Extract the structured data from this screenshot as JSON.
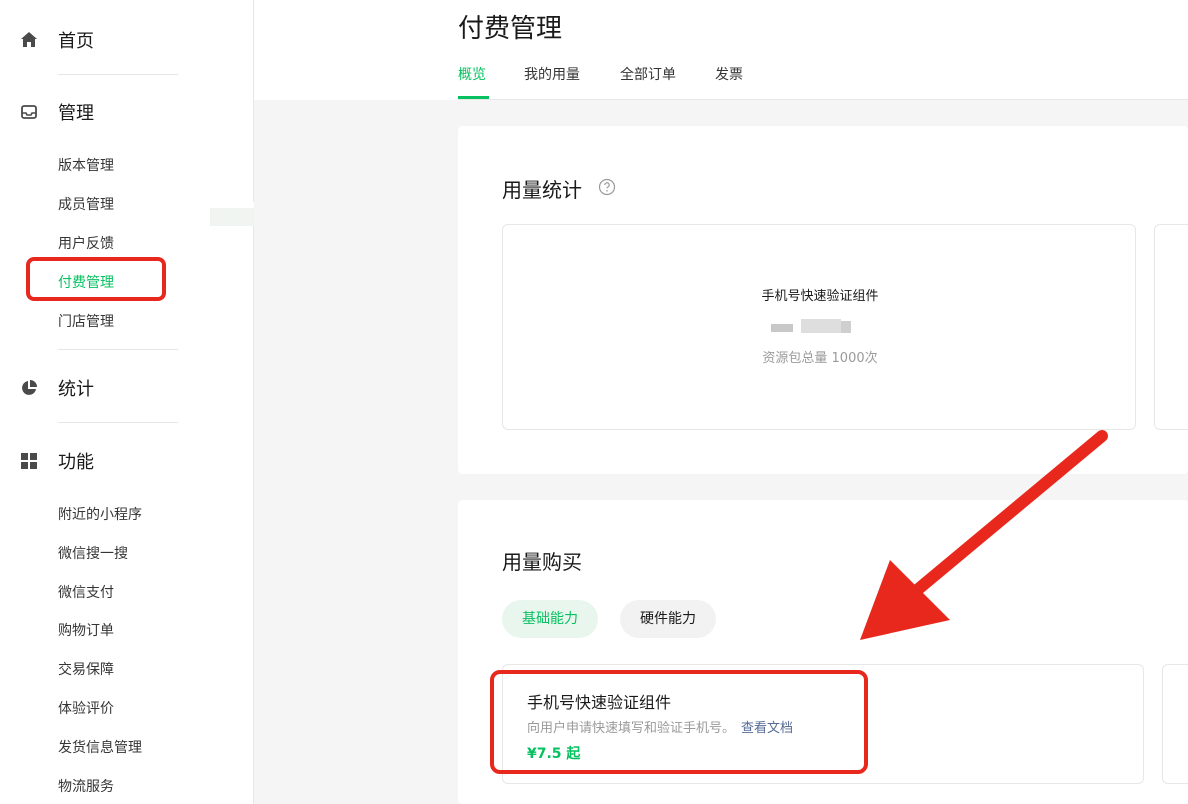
{
  "sidebar": {
    "sections": [
      {
        "label": "首页",
        "icon": "home-icon"
      },
      {
        "label": "管理",
        "icon": "inbox-icon"
      },
      {
        "label": "统计",
        "icon": "pie-chart-icon"
      },
      {
        "label": "功能",
        "icon": "grid-icon"
      }
    ],
    "manage_items": [
      "版本管理",
      "成员管理",
      "用户反馈",
      "付费管理",
      "门店管理"
    ],
    "feature_items": [
      "附近的小程序",
      "微信搜一搜",
      "微信支付",
      "购物订单",
      "交易保障",
      "体验评价",
      "发货信息管理",
      "物流服务"
    ],
    "active_item": "付费管理"
  },
  "header": {
    "title": "付费管理",
    "tabs": [
      "概览",
      "我的用量",
      "全部订单",
      "发票"
    ],
    "active_tab": "概览"
  },
  "usage_stats": {
    "title": "用量统计",
    "item_name": "手机号快速验证组件",
    "total_text": "资源包总量 1000次"
  },
  "usage_purchase": {
    "title": "用量购买",
    "pills": [
      "基础能力",
      "硬件能力"
    ],
    "product": {
      "name": "手机号快速验证组件",
      "desc": "向用户申请快速填写和验证手机号。",
      "doc_link": "查看文档",
      "price": "¥7.5 起"
    }
  },
  "colors": {
    "accent": "#07c160",
    "annotation": "#e8281d",
    "link": "#576b95"
  }
}
